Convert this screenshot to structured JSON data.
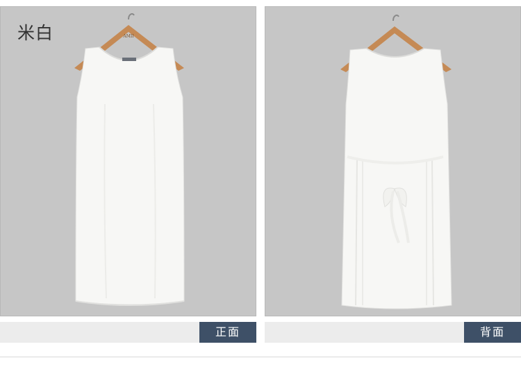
{
  "color_name": "米白",
  "views": {
    "front_label": "正面",
    "back_label": "背面"
  },
  "hanger_brand": "AMII",
  "colors": {
    "panel_bg": "#c6c6c6",
    "tag_bg": "#3e5067",
    "bar_bg": "#ececec",
    "dress": "#f7f7f5"
  }
}
